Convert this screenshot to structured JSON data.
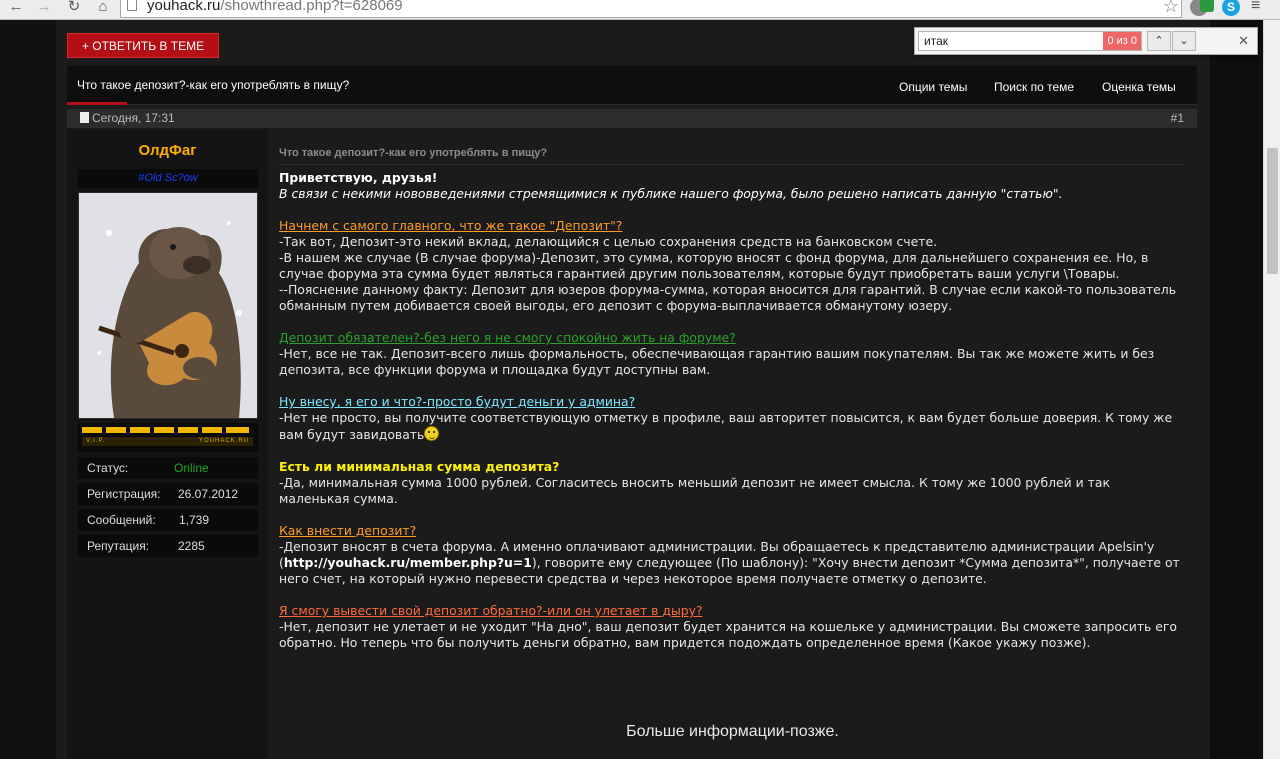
{
  "browser": {
    "url_host": "youhack.ru",
    "url_path": "/showthread.php?t=628069"
  },
  "find": {
    "query": "итак",
    "count": "0 из 0"
  },
  "reply_button": "+ ОТВЕТИТЬ В ТЕМЕ",
  "thread": {
    "title": "Что такое депозит?-как его употреблять в пищу?",
    "tools": [
      "Опции темы",
      "Поиск по теме",
      "Оценка темы"
    ]
  },
  "post": {
    "date": "Сегодня, 17:31",
    "number": "#1",
    "title": "Что такое депозит?-как его употреблять в пищу?",
    "greeting": "Приветствую, друзья!",
    "intro": "В связи с некими нововведениями стремящимися к публике нашего форума, было решено написать данную \"статью\".",
    "s1_heading": "Начнем с самого главного, что же такое \"Депозит\"?",
    "s1_p1": "-Так вот, Депозит-это некий вклад, делающийся с целью сохранения средств на банковском счете.",
    "s1_p2": "-В нашем же случае (В случае форума)-Депозит, это сумма, которую вносят с фонд форума, для дальнейшего сохранения ее. Но, в случае форума эта сумма будет являться гарантией другим пользователям, которые будут приобретать ваши услуги \\Товары.",
    "s1_p3": "--Пояснение данному факту: Депозит для юзеров форума-сумма, которая вносится для гарантий. В случае если какой-то пользователь обманным путем добивается своей выгоды, его депозит с форума-выплачивается обманутому юзеру.",
    "s2_heading": "Депозит обязателен?-без него я не смогу спокойно жить на форуме?",
    "s2_p1": "-Нет, все не так. Депозит-всего лишь формальность, обеспечивающая гарантию вашим покупателям. Вы так же можете жить и без депозита, все функции форума и площадка будут доступны вам.",
    "s3_heading": "Ну внесу, я его и что?-просто будут деньги у админа?",
    "s3_p1": "-Нет не просто, вы получите соответствующую отметку в профиле, ваш авторитет повысится, к вам будет больше доверия. К тому же вам будут завидовать",
    "s4_heading": "Есть ли минимальная сумма депозита?",
    "s4_p1": "-Да, минимальная сумма 1000 рублей. Согласитесь вносить меньший депозит не имеет смысла. К тому же 1000 рублей и так маленькая сумма.",
    "s5_heading": "Как внести депозит?",
    "s5_p1_a": "-Депозит вносят в счета форума. А именно оплачивают администрации. Вы обращаетесь к представителю администрации Apelsin'y (",
    "s5_link": "http://youhack.ru/member.php?u=1",
    "s5_p1_b": "), говорите ему следующее (По шаблону): \"Хочу внести депозит *Сумма депозита*\", получаете от него счет, на который нужно перевести средства и через некоторое время получаете отметку о депозите.",
    "s6_heading": "Я смогу вывести свой депозит обратно?-или он улетает в дыру?",
    "s6_p1": "-Нет, депозит не улетает и не уходит \"На дно\", ваш депозит будет хранится на кошельке у администрации. Вы сможете запросить его обратно. Но теперь что бы получить деньги обратно, вам придется подождать определенное время (Какое укажу позже).",
    "more": "Больше информации-позже."
  },
  "user": {
    "name": "ОлдФаг",
    "usertitle": "#Old Sc?ow",
    "vip_left": "V.I.P.",
    "vip_right": "YOUHACK.RU",
    "status_label": "Статус:",
    "status_value": "Online",
    "status_color": "#1fa81f",
    "reg_label": "Регистрация:",
    "reg_value": "26.07.2012",
    "posts_label": "Сообщений:",
    "posts_value": "1,739",
    "rep_label": "Репутация:",
    "rep_value": "2285"
  },
  "colors": {
    "accent": "#b40f14",
    "username": "#ffae00"
  }
}
